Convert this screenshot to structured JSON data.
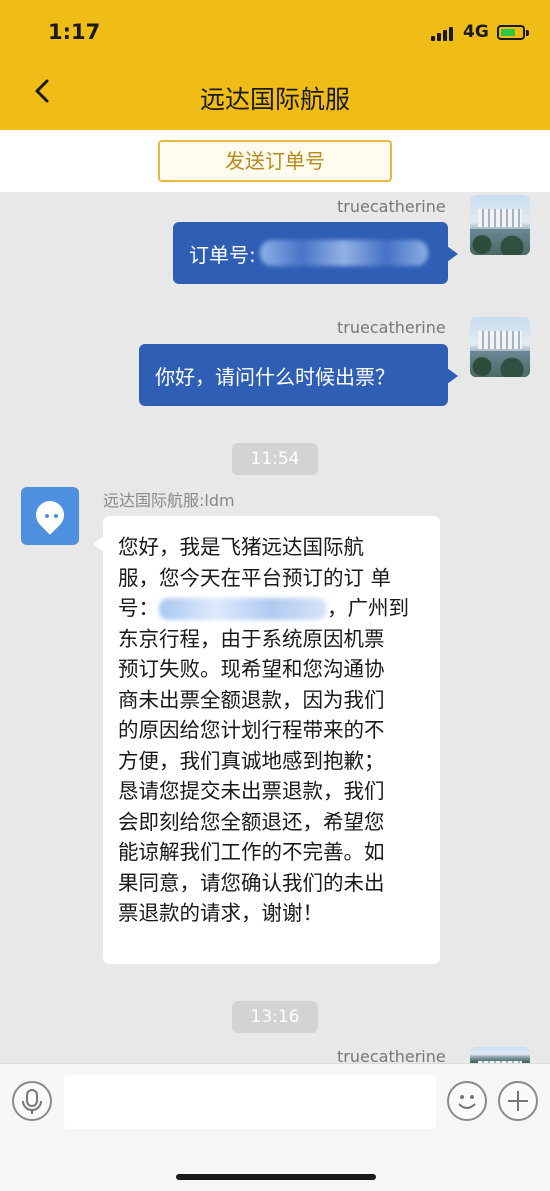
{
  "status": {
    "time": "1:17",
    "network": "4G"
  },
  "nav": {
    "title": "远达国际航服",
    "back_icon": "chevron-left-icon"
  },
  "send_order": {
    "label": "发送订单号"
  },
  "messages": [
    {
      "sender": "truecatherine",
      "prefix": "订单号:",
      "redacted": true
    },
    {
      "sender": "truecatherine",
      "text": "你好，请问什么时候出票？"
    }
  ],
  "timestamps": [
    "11:54",
    "13:16"
  ],
  "reply": {
    "sender": "远达国际航服:ldm",
    "lines": [
      "您好，我是飞猪远达国际航",
      "服，您今天在平台预订的订 单",
      "号：",
      "，广州到",
      "东京行程，由于系统原因机票",
      "预订失败。现希望和您沟通协",
      "商未出票全额退款，因为我们",
      "的原因给您计划行程带来的不",
      "方便，我们真诚地感到抱歉；",
      "恳请您提交未出票退款，我们",
      "会即刻给您全额退还，希望您",
      "能谅解我们工作的不完善。如",
      "果同意，请您确认我们的未出",
      "票退款的请求，谢谢！"
    ]
  },
  "last_sender": "truecatherine",
  "input": {
    "placeholder": ""
  },
  "colors": {
    "header": "#f0bd17",
    "bubble_out": "#2f5eb5",
    "chat_bg": "#e8e8e8"
  }
}
